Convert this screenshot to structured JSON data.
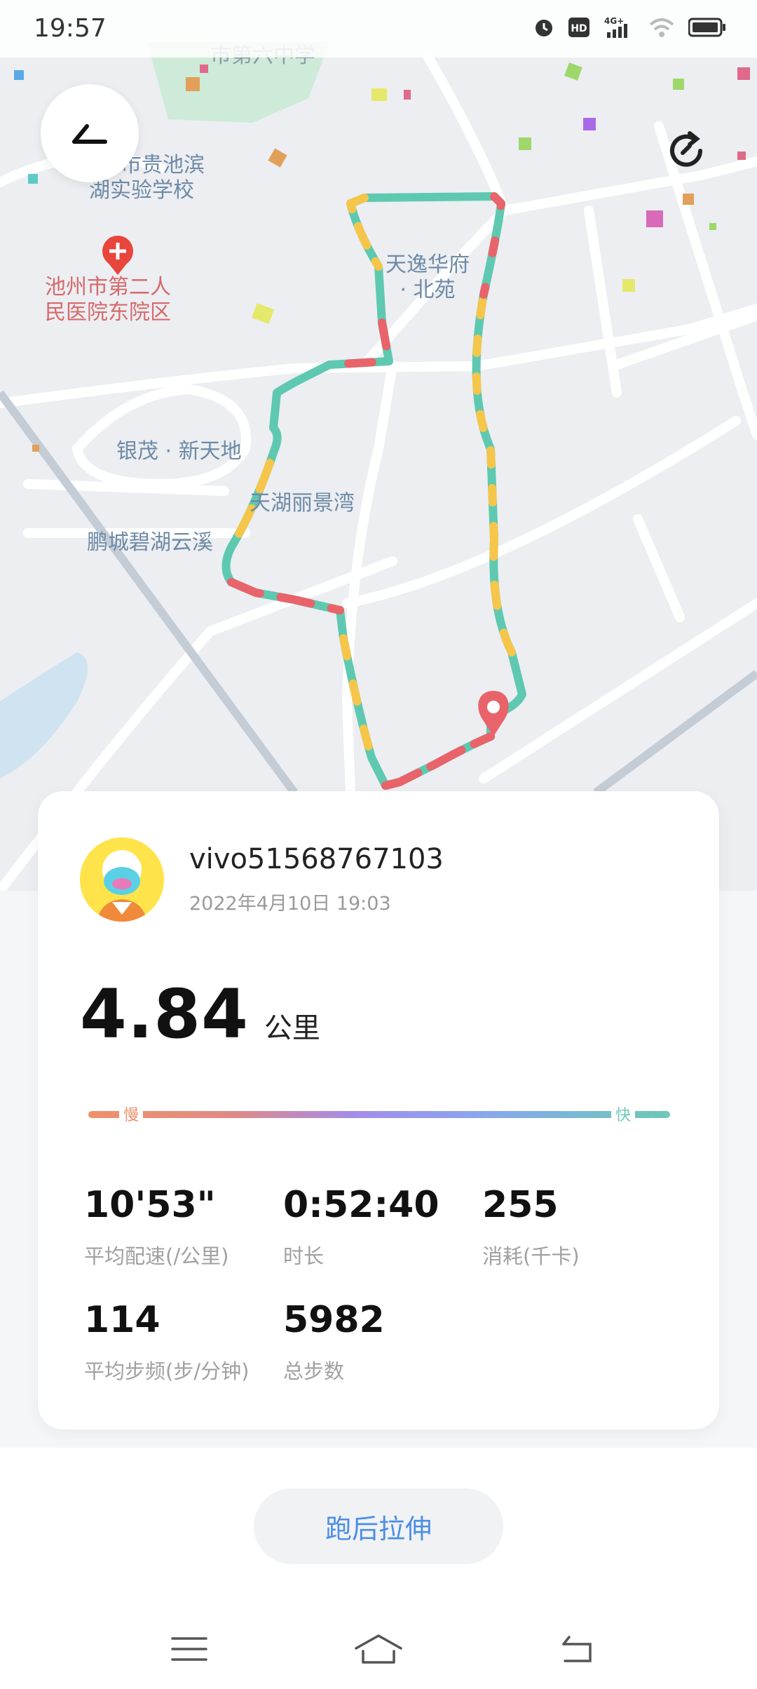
{
  "status": {
    "time": "19:57"
  },
  "map": {
    "labels": [
      {
        "id": "school",
        "text": "池州市贵池滨\n湖实验学校",
        "lines": [
          "池州市贵池滨",
          "湖实验学校"
        ]
      },
      {
        "id": "hospital",
        "text": "池州市第二人\n民医院东院区",
        "lines": [
          "池州市第二人",
          "民医院东院区"
        ]
      },
      {
        "id": "tianyi",
        "lines": [
          "天逸华府",
          "· 北苑"
        ]
      },
      {
        "id": "yinmao",
        "lines": [
          "银茂 · 新天地"
        ]
      },
      {
        "id": "tianhu",
        "lines": [
          "天湖丽景湾"
        ]
      },
      {
        "id": "pengcheng",
        "lines": [
          "鹏城碧湖云溪"
        ]
      },
      {
        "id": "top-partial",
        "lines": [
          "市第六中学"
        ]
      }
    ]
  },
  "card": {
    "username": "vivo51568767103",
    "datetime": "2022年4月10日  19:03",
    "distance": "4.84",
    "distance_unit": "公里",
    "pace_slow_label": "慢",
    "pace_fast_label": "快",
    "stats": [
      {
        "value": "10'53\"",
        "label": "平均配速(/公里)"
      },
      {
        "value": "0:52:40",
        "label": "时长"
      },
      {
        "value": "255",
        "label": "消耗(千卡)"
      },
      {
        "value": "114",
        "label": "平均步频(步/分钟)"
      },
      {
        "value": "5982",
        "label": "总步数"
      }
    ]
  },
  "actions": {
    "stretch_label": "跑后拉伸"
  },
  "colors": {
    "accent": "#4a8ee6",
    "route_green": "#5ec9b0",
    "route_yellow": "#f5c64a",
    "route_red": "#e8646a"
  }
}
